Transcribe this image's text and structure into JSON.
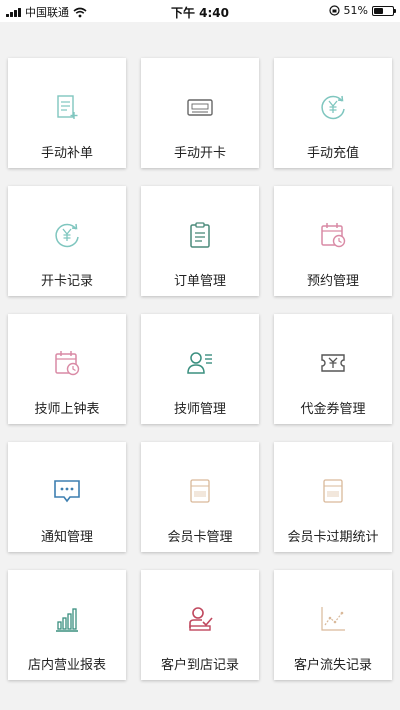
{
  "status_bar": {
    "carrier": "中国联通",
    "time": "下午 4:40",
    "battery": "51%",
    "battery_level": 0.51,
    "icons": [
      "signal-icon",
      "wifi-icon",
      "rotation-lock-icon",
      "battery-icon"
    ]
  },
  "menu": {
    "items": [
      {
        "label": "手动补单",
        "icon": "document-add-icon",
        "color": "#7fc6bf"
      },
      {
        "label": "手动开卡",
        "icon": "card-icon",
        "color": "#666666"
      },
      {
        "label": "手动充值",
        "icon": "yuan-refresh-icon",
        "color": "#7fc6bf"
      },
      {
        "label": "开卡记录",
        "icon": "yuan-refresh-icon",
        "color": "#7fc6bf"
      },
      {
        "label": "订单管理",
        "icon": "clipboard-icon",
        "color": "#4a8a7a"
      },
      {
        "label": "预约管理",
        "icon": "calendar-clock-icon",
        "color": "#d98aa5"
      },
      {
        "label": "技师上钟表",
        "icon": "calendar-clock-icon",
        "color": "#d98aa5"
      },
      {
        "label": "技师管理",
        "icon": "person-list-icon",
        "color": "#3a8f7f"
      },
      {
        "label": "代金券管理",
        "icon": "voucher-icon",
        "color": "#555555"
      },
      {
        "label": "通知管理",
        "icon": "chat-bubble-icon",
        "color": "#3d7fb0"
      },
      {
        "label": "会员卡管理",
        "icon": "vip-card-icon",
        "color": "#d9b99a"
      },
      {
        "label": "会员卡过期统计",
        "icon": "vip-card-icon",
        "color": "#d9b99a"
      },
      {
        "label": "店内营业报表",
        "icon": "bar-chart-icon",
        "color": "#3a8f7f"
      },
      {
        "label": "客户到店记录",
        "icon": "person-check-icon",
        "color": "#c0485e"
      },
      {
        "label": "客户流失记录",
        "icon": "line-chart-icon",
        "color": "#d9b99a"
      }
    ]
  }
}
